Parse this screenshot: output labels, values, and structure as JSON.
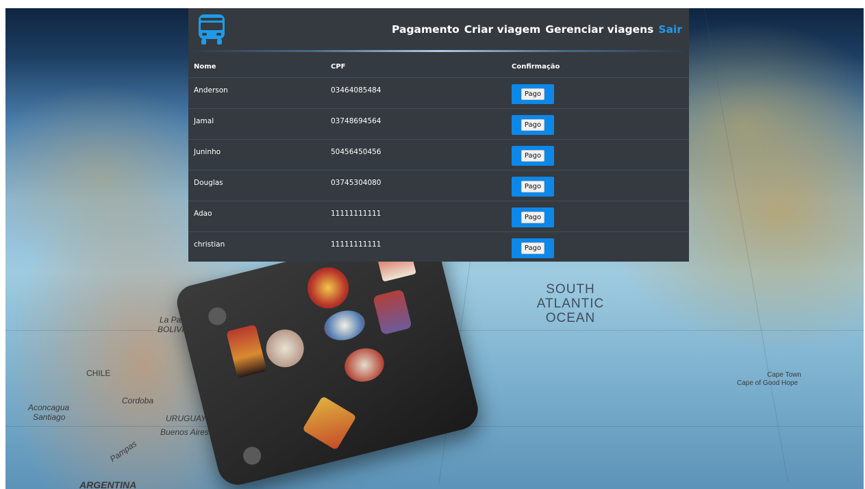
{
  "navbar": {
    "logo_icon": "bus-icon",
    "links": [
      {
        "label": "Pagamento"
      },
      {
        "label": "Criar viagem"
      },
      {
        "label": "Gerenciar viagens"
      },
      {
        "label": "Sair"
      }
    ],
    "accent_color": "#1f9be8"
  },
  "table": {
    "headers": [
      "Nome",
      "CPF",
      "Confirmação"
    ],
    "rows": [
      {
        "nome": "Anderson",
        "cpf": "03464085484",
        "confirmacao": "Pago"
      },
      {
        "nome": "Jamal",
        "cpf": "03748694564",
        "confirmacao": "Pago"
      },
      {
        "nome": "Juninho",
        "cpf": "50456450456",
        "confirmacao": "Pago"
      },
      {
        "nome": "Douglas",
        "cpf": "03745304080",
        "confirmacao": "Pago"
      },
      {
        "nome": "Adao",
        "cpf": "11111111111",
        "confirmacao": "Pago"
      },
      {
        "nome": "christian",
        "cpf": "11111111111",
        "confirmacao": "Pago"
      }
    ]
  },
  "background": {
    "labels": {
      "ocean": "SOUTH ATLANTIC OCEAN",
      "argentina": "ARGENTINA",
      "chile": "CHILE",
      "bolivia": "BOLIVIA",
      "la_paz": "La Paz",
      "cordoba": "Cordoba",
      "aconcagua": "Aconcagua",
      "santiago": "Santiago",
      "uruguay": "URUGUAY",
      "buenos_aires": "Buenos Aires",
      "pampas": "Pampas",
      "cape_town": "Cape Town",
      "cape_of_good_hope": "Cape of Good Hope"
    }
  },
  "colors": {
    "panel_bg": "#343a40",
    "button_bg": "#0d88e8"
  }
}
